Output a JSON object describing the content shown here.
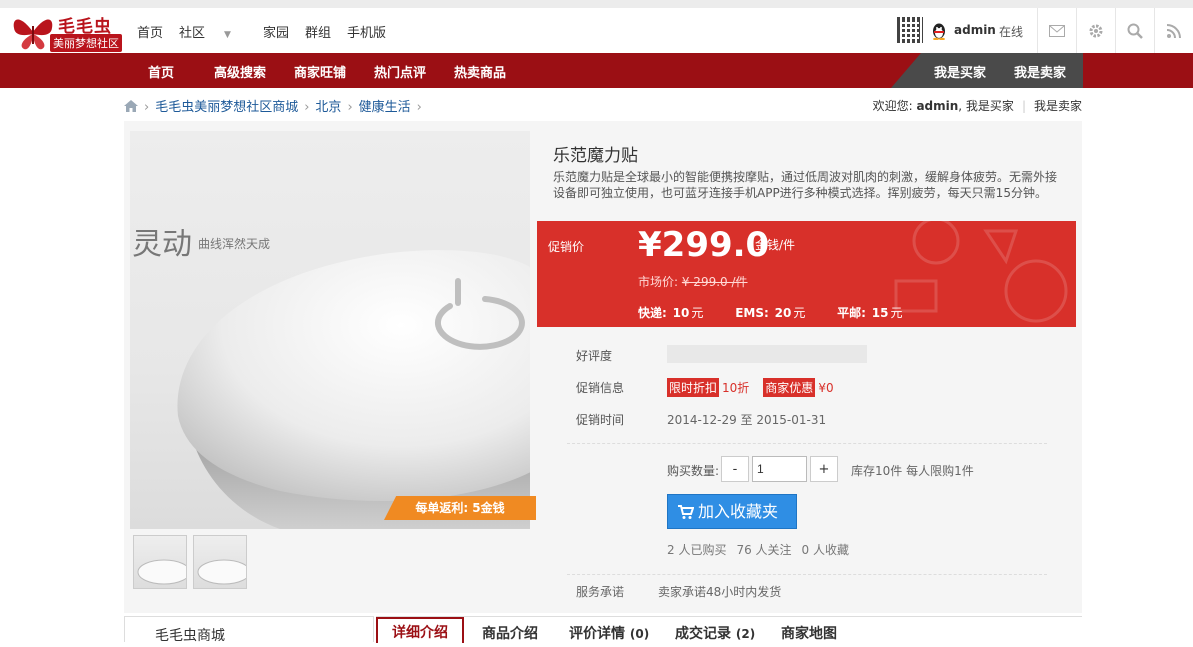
{
  "brand": {
    "title": "毛毛虫",
    "subtitle": "美丽梦想社区"
  },
  "topnav": [
    {
      "label": "首页"
    },
    {
      "label": "社区"
    },
    {
      "label": "家园"
    },
    {
      "label": "群组"
    },
    {
      "label": "手机版"
    }
  ],
  "user": {
    "name": "admin",
    "status": "在线"
  },
  "rednav": [
    {
      "label": "首页"
    },
    {
      "label": "高级搜索"
    },
    {
      "label": "商家旺铺"
    },
    {
      "label": "热门点评"
    },
    {
      "label": "热卖商品"
    }
  ],
  "role_nav": {
    "buyer": "我是买家",
    "seller": "我是卖家"
  },
  "breadcrumb": [
    {
      "label": "毛毛虫美丽梦想社区商城"
    },
    {
      "label": "北京"
    },
    {
      "label": "健康生活"
    }
  ],
  "welcome": {
    "prefix": "欢迎您: ",
    "user": "admin",
    "suffix": ", 我是买家",
    "seller_link": "我是卖家"
  },
  "product": {
    "image_caption_big": "灵动",
    "image_caption_small": "曲线浑然天成",
    "rebate_badge": "每单返利: 5金钱",
    "title": "乐范魔力贴",
    "description": "乐范魔力贴是全球最小的智能便携按摩贴，通过低周波对肌肉的刺激，缓解身体疲劳。无需外接设备即可独立使用，也可蓝牙连接手机APP进行多种模式选择。挥别疲劳，每天只需15分钟。",
    "price_label": "促销价",
    "price": "¥299.0",
    "price_unit": "金钱/件",
    "market_label": "市场价: ",
    "market_price": "¥ 299.0 /件",
    "shipping": [
      {
        "name": "快递:",
        "value": "10",
        "unit": "元"
      },
      {
        "name": "EMS:",
        "value": "20",
        "unit": "元"
      },
      {
        "name": "平邮:",
        "value": "15",
        "unit": "元"
      }
    ],
    "rating_label": "好评度",
    "promo_label": "促销信息",
    "promo_tag1": "限时折扣",
    "promo_val1": "10折",
    "promo_tag2": "商家优惠",
    "promo_val2": "¥0",
    "promo_time_label": "促销时间",
    "promo_time": "2014-12-29 至 2015-01-31",
    "qty_label": "购买数量:",
    "qty_value": "1",
    "minus": "-",
    "plus": "+",
    "stock": "库存10件 每人限购1件",
    "add_button": "加入收藏夹",
    "stats": [
      "2 人已购买",
      "76 人关注",
      "0 人收藏"
    ],
    "service_label": "服务承诺",
    "service_text": "卖家承诺48小时内发货"
  },
  "bottom": {
    "shop_name": "毛毛虫商城",
    "tabs": [
      {
        "label": "详细介绍",
        "count": ""
      },
      {
        "label": "商品介绍",
        "count": ""
      },
      {
        "label": "评价详情",
        "count": "(0)"
      },
      {
        "label": "成交记录",
        "count": "(2)"
      },
      {
        "label": "商家地图",
        "count": ""
      }
    ]
  },
  "colors": {
    "brand_red": "#9b0f14",
    "price_red": "#d8302a",
    "button_blue": "#2f8ee4",
    "badge_orange": "#f08a22"
  }
}
